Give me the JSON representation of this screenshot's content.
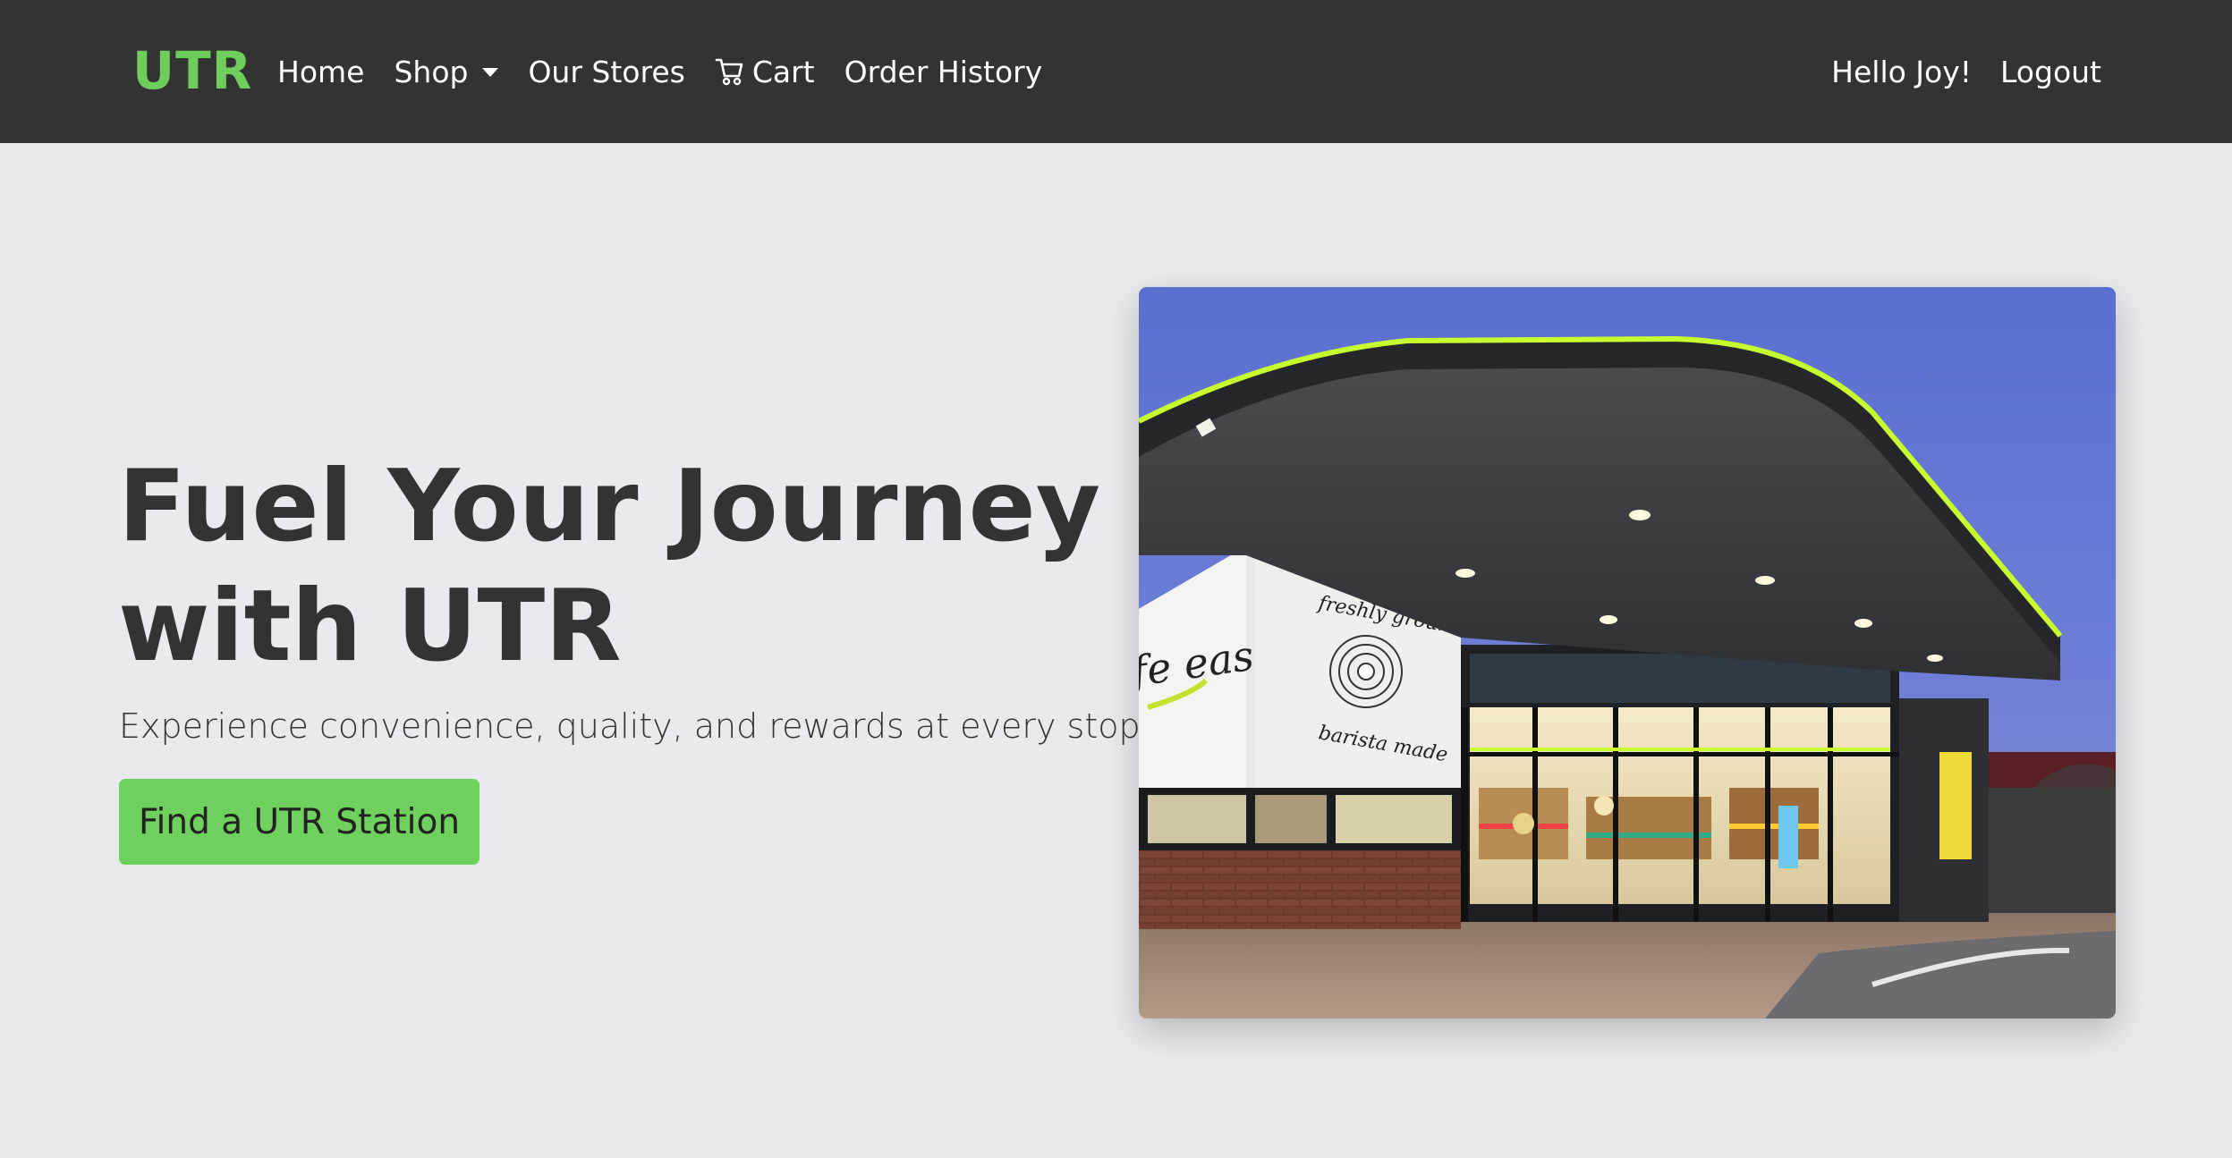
{
  "navbar": {
    "brand": "UTR",
    "links": [
      {
        "label": "Home"
      },
      {
        "label": "Shop",
        "icon": "caret-down-icon"
      },
      {
        "label": "Our Stores"
      },
      {
        "label": "Cart",
        "icon": "cart-icon"
      },
      {
        "label": "Order History"
      }
    ],
    "greeting": "Hello Joy!",
    "logout": "Logout"
  },
  "hero": {
    "title": "Fuel Your Journey with UTR",
    "subtitle": "Experience convenience, quality, and rewards at every stop.",
    "cta": "Find a UTR Station"
  },
  "store_image": {
    "signs": {
      "cafe": "fe easy",
      "coffee_top": "freshly ground",
      "coffee_bottom": "barista made"
    }
  },
  "colors": {
    "navbar_bg": "#333333",
    "brand_green": "#6fce5b",
    "page_bg": "#e9eaed",
    "text_dark": "#333333",
    "button_green": "#6fd15d",
    "canopy_glow": "#c8ff2e"
  }
}
